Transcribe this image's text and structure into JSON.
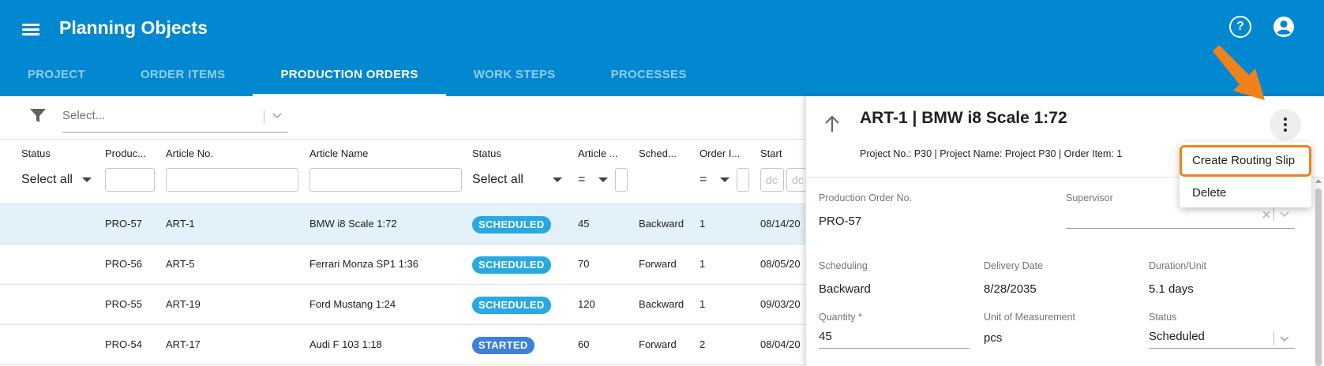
{
  "app": {
    "title": "Planning Objects",
    "help_icon": "help-circle-icon",
    "account_icon": "account-circle-icon",
    "brand_color": "#0288d1"
  },
  "tabs": [
    {
      "label": "PROJECT",
      "active": false
    },
    {
      "label": "ORDER ITEMS",
      "active": false
    },
    {
      "label": "PRODUCTION ORDERS",
      "active": true
    },
    {
      "label": "WORK STEPS",
      "active": false
    },
    {
      "label": "PROCESSES",
      "active": false
    }
  ],
  "filter": {
    "placeholder": "Select..."
  },
  "grid": {
    "columns": [
      "Status",
      "Produc...",
      "Article No.",
      "Article Name",
      "Status",
      "Article ...",
      "Sched...",
      "Order I...",
      "Start"
    ],
    "filters": {
      "status_select": "Select all",
      "status2_select": "Select all",
      "article_qty_op": "=",
      "order_item_op": "=",
      "date_placeholder": "dc"
    },
    "rows": [
      {
        "order": "PRO-57",
        "article_no": "ART-1",
        "article_name": "BMW i8 Scale 1:72",
        "status": "SCHEDULED",
        "qty": "45",
        "scheduling": "Backward",
        "order_item": "1",
        "start": "08/14/20",
        "selected": true
      },
      {
        "order": "PRO-56",
        "article_no": "ART-5",
        "article_name": "Ferrari Monza SP1 1:36",
        "status": "SCHEDULED",
        "qty": "70",
        "scheduling": "Forward",
        "order_item": "1",
        "start": "08/05/20",
        "selected": false
      },
      {
        "order": "PRO-55",
        "article_no": "ART-19",
        "article_name": "Ford Mustang 1:24",
        "status": "SCHEDULED",
        "qty": "120",
        "scheduling": "Backward",
        "order_item": "1",
        "start": "09/03/20",
        "selected": false
      },
      {
        "order": "PRO-54",
        "article_no": "ART-17",
        "article_name": "Audi F 103 1:18",
        "status": "STARTED",
        "qty": "60",
        "scheduling": "Forward",
        "order_item": "2",
        "start": "08/04/20",
        "selected": false
      }
    ],
    "status_colors": {
      "SCHEDULED": "#29a9e1",
      "STARTED": "#3d7fd9"
    }
  },
  "detail": {
    "title": "ART-1 | BMW i8 Scale 1:72",
    "subtitle": "Project No.: P30 | Project Name: Project P30 | Order Item: 1",
    "fields": {
      "production_order_no": {
        "label": "Production Order No.",
        "value": "PRO-57"
      },
      "supervisor": {
        "label": "Supervisor",
        "value": ""
      },
      "scheduling": {
        "label": "Scheduling",
        "value": "Backward"
      },
      "delivery_date": {
        "label": "Delivery Date",
        "value": "8/28/2035"
      },
      "duration_unit": {
        "label": "Duration/Unit",
        "value": "5.1 days"
      },
      "quantity": {
        "label": "Quantity *",
        "value": "45"
      },
      "unit_of_measurement": {
        "label": "Unit of Measurement",
        "value": "pcs"
      },
      "status": {
        "label": "Status",
        "value": "Scheduled"
      }
    }
  },
  "context_menu": {
    "items": [
      {
        "label": "Create Routing Slip",
        "highlighted": true
      },
      {
        "label": "Delete",
        "highlighted": false
      }
    ],
    "highlight_color": "#f08219"
  }
}
